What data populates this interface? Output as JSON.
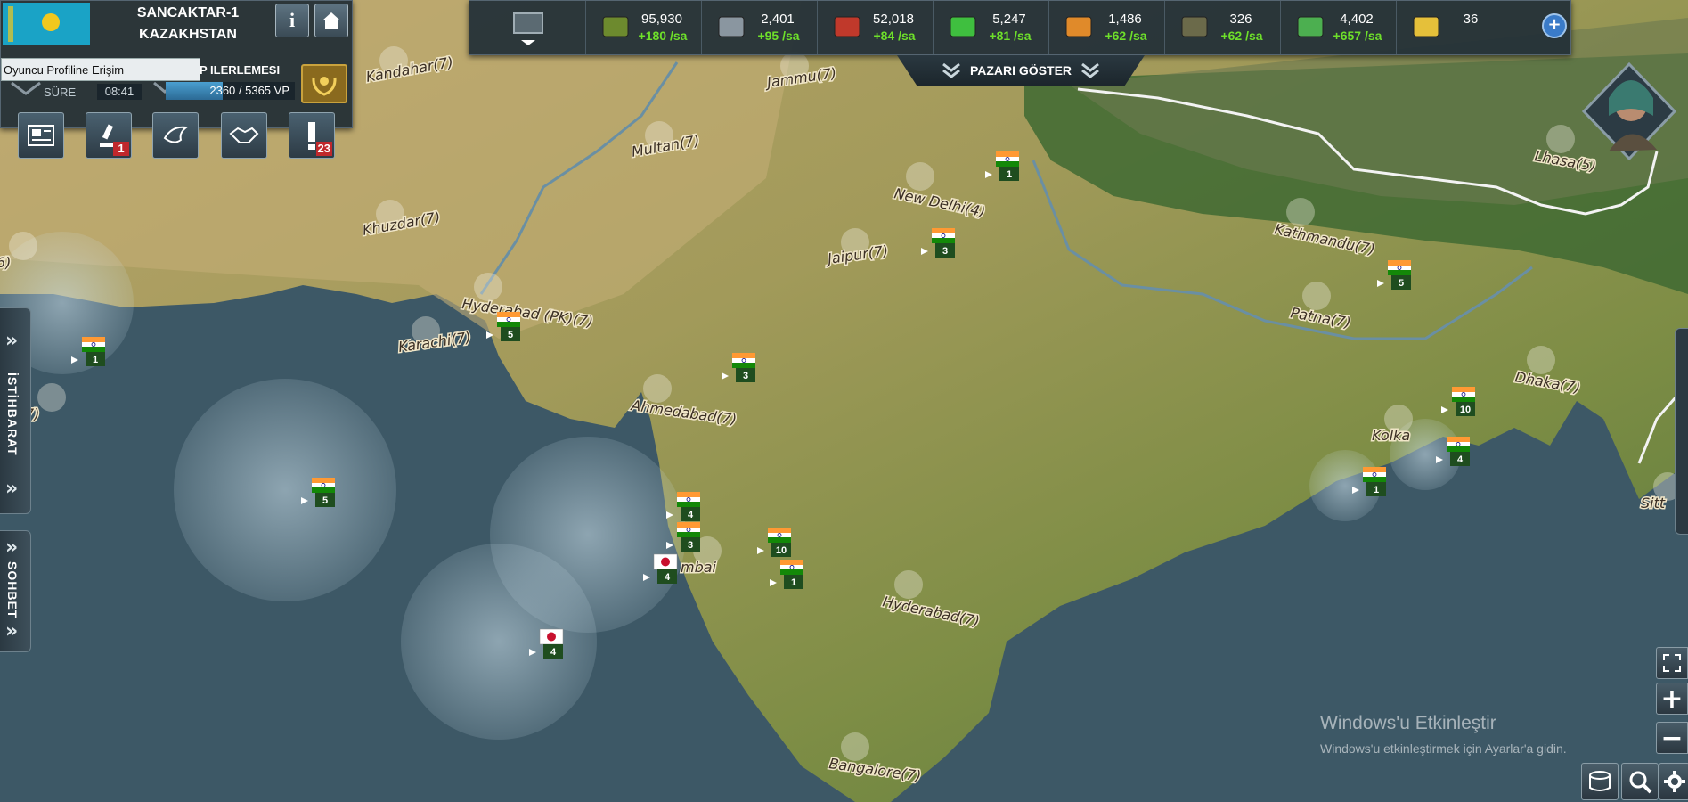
{
  "player": {
    "name_line1": "SANCAKTAR-1",
    "name_line2": "KAZAKHSTAN",
    "tooltip": "Oyuncu Profiline Erişim",
    "progress_title": "KIP ILERLEMESI",
    "progress_text": "2360 / 5365 VP",
    "progress_fraction": 0.44,
    "time_label": "SÜRE",
    "time_value": "08:41",
    "info_label": "i"
  },
  "actions": [
    {
      "name": "newspaper-button",
      "icon": "newspaper-icon",
      "badge": ""
    },
    {
      "name": "research-button",
      "icon": "microscope-icon",
      "badge": "1"
    },
    {
      "name": "diplomacy-button",
      "icon": "dove-icon",
      "badge": ""
    },
    {
      "name": "alliance-button",
      "icon": "handshake-icon",
      "badge": ""
    },
    {
      "name": "alerts-button",
      "icon": "exclamation-icon",
      "badge": "23"
    }
  ],
  "resources": [
    {
      "name": "supplies",
      "icon": "crate-icon",
      "value": "95,930",
      "rate": "+180 /sa",
      "color": "#6d8a2e"
    },
    {
      "name": "components",
      "icon": "gear-icon",
      "value": "2,401",
      "rate": "+95 /sa",
      "color": "#8a96a0"
    },
    {
      "name": "fuel",
      "icon": "jerrycan-icon",
      "value": "52,018",
      "rate": "+84 /sa",
      "color": "#c0392b"
    },
    {
      "name": "electronics",
      "icon": "circuit-icon",
      "value": "5,247",
      "rate": "+81 /sa",
      "color": "#3fbf3f"
    },
    {
      "name": "rare-materials",
      "icon": "rocket-icon",
      "value": "1,486",
      "rate": "+62 /sa",
      "color": "#e08a2a"
    },
    {
      "name": "manpower",
      "icon": "helmet-icon",
      "value": "326",
      "rate": "+62 /sa",
      "color": "#6b6a4a"
    },
    {
      "name": "money",
      "icon": "cash-icon",
      "value": "4,402",
      "rate": "+657 /sa",
      "color": "#4caf50"
    },
    {
      "name": "gold",
      "icon": "gold-bars-icon",
      "value": "36",
      "rate": "",
      "color": "#e5c03a"
    }
  ],
  "market_label": "PAZARI GÖSTER",
  "side_tabs": {
    "intel": "İSTİHBARAT",
    "chat": "SOHBET"
  },
  "watermark": {
    "title": "Windows'u Etkinleştir",
    "subtitle": "Windows'u etkinleştirmek için Ayarlar'a gidin."
  },
  "cities": [
    {
      "label": "Kandahar(7)"
    },
    {
      "label": "Jammu(7)"
    },
    {
      "label": "Multan(7)"
    },
    {
      "label": "New Delhi(4)"
    },
    {
      "label": "Lhasa(5)"
    },
    {
      "label": "Khuzdar(7)"
    },
    {
      "label": "Jaipur(7)"
    },
    {
      "label": "Kathmandu(7)"
    },
    {
      "label": "Hyderabad (PK)(7)"
    },
    {
      "label": "Karachi(7)"
    },
    {
      "label": "Patna(7)"
    },
    {
      "label": "Dhaka(7)"
    },
    {
      "label": "Ahmedabad(7)"
    },
    {
      "label": "Kolka"
    },
    {
      "label": "mbai"
    },
    {
      "label": "Hyderabad(7)"
    },
    {
      "label": "Bangalore(7)"
    },
    {
      "label": "Sitt"
    },
    {
      "label": "6)"
    },
    {
      "label": "7)"
    }
  ],
  "units": [
    {
      "nation": "india",
      "count": "1"
    },
    {
      "nation": "india",
      "count": "3"
    },
    {
      "nation": "india",
      "count": "5"
    },
    {
      "nation": "india",
      "count": "5"
    },
    {
      "nation": "india",
      "count": "1"
    },
    {
      "nation": "india",
      "count": "3"
    },
    {
      "nation": "india",
      "count": "10"
    },
    {
      "nation": "india",
      "count": "4"
    },
    {
      "nation": "india",
      "count": "1"
    },
    {
      "nation": "india",
      "count": "5"
    },
    {
      "nation": "india",
      "count": "4"
    },
    {
      "nation": "india",
      "count": "3"
    },
    {
      "nation": "india",
      "count": "10"
    },
    {
      "nation": "india",
      "count": "1"
    },
    {
      "nation": "japan",
      "count": "4"
    },
    {
      "nation": "japan",
      "count": "4"
    }
  ]
}
